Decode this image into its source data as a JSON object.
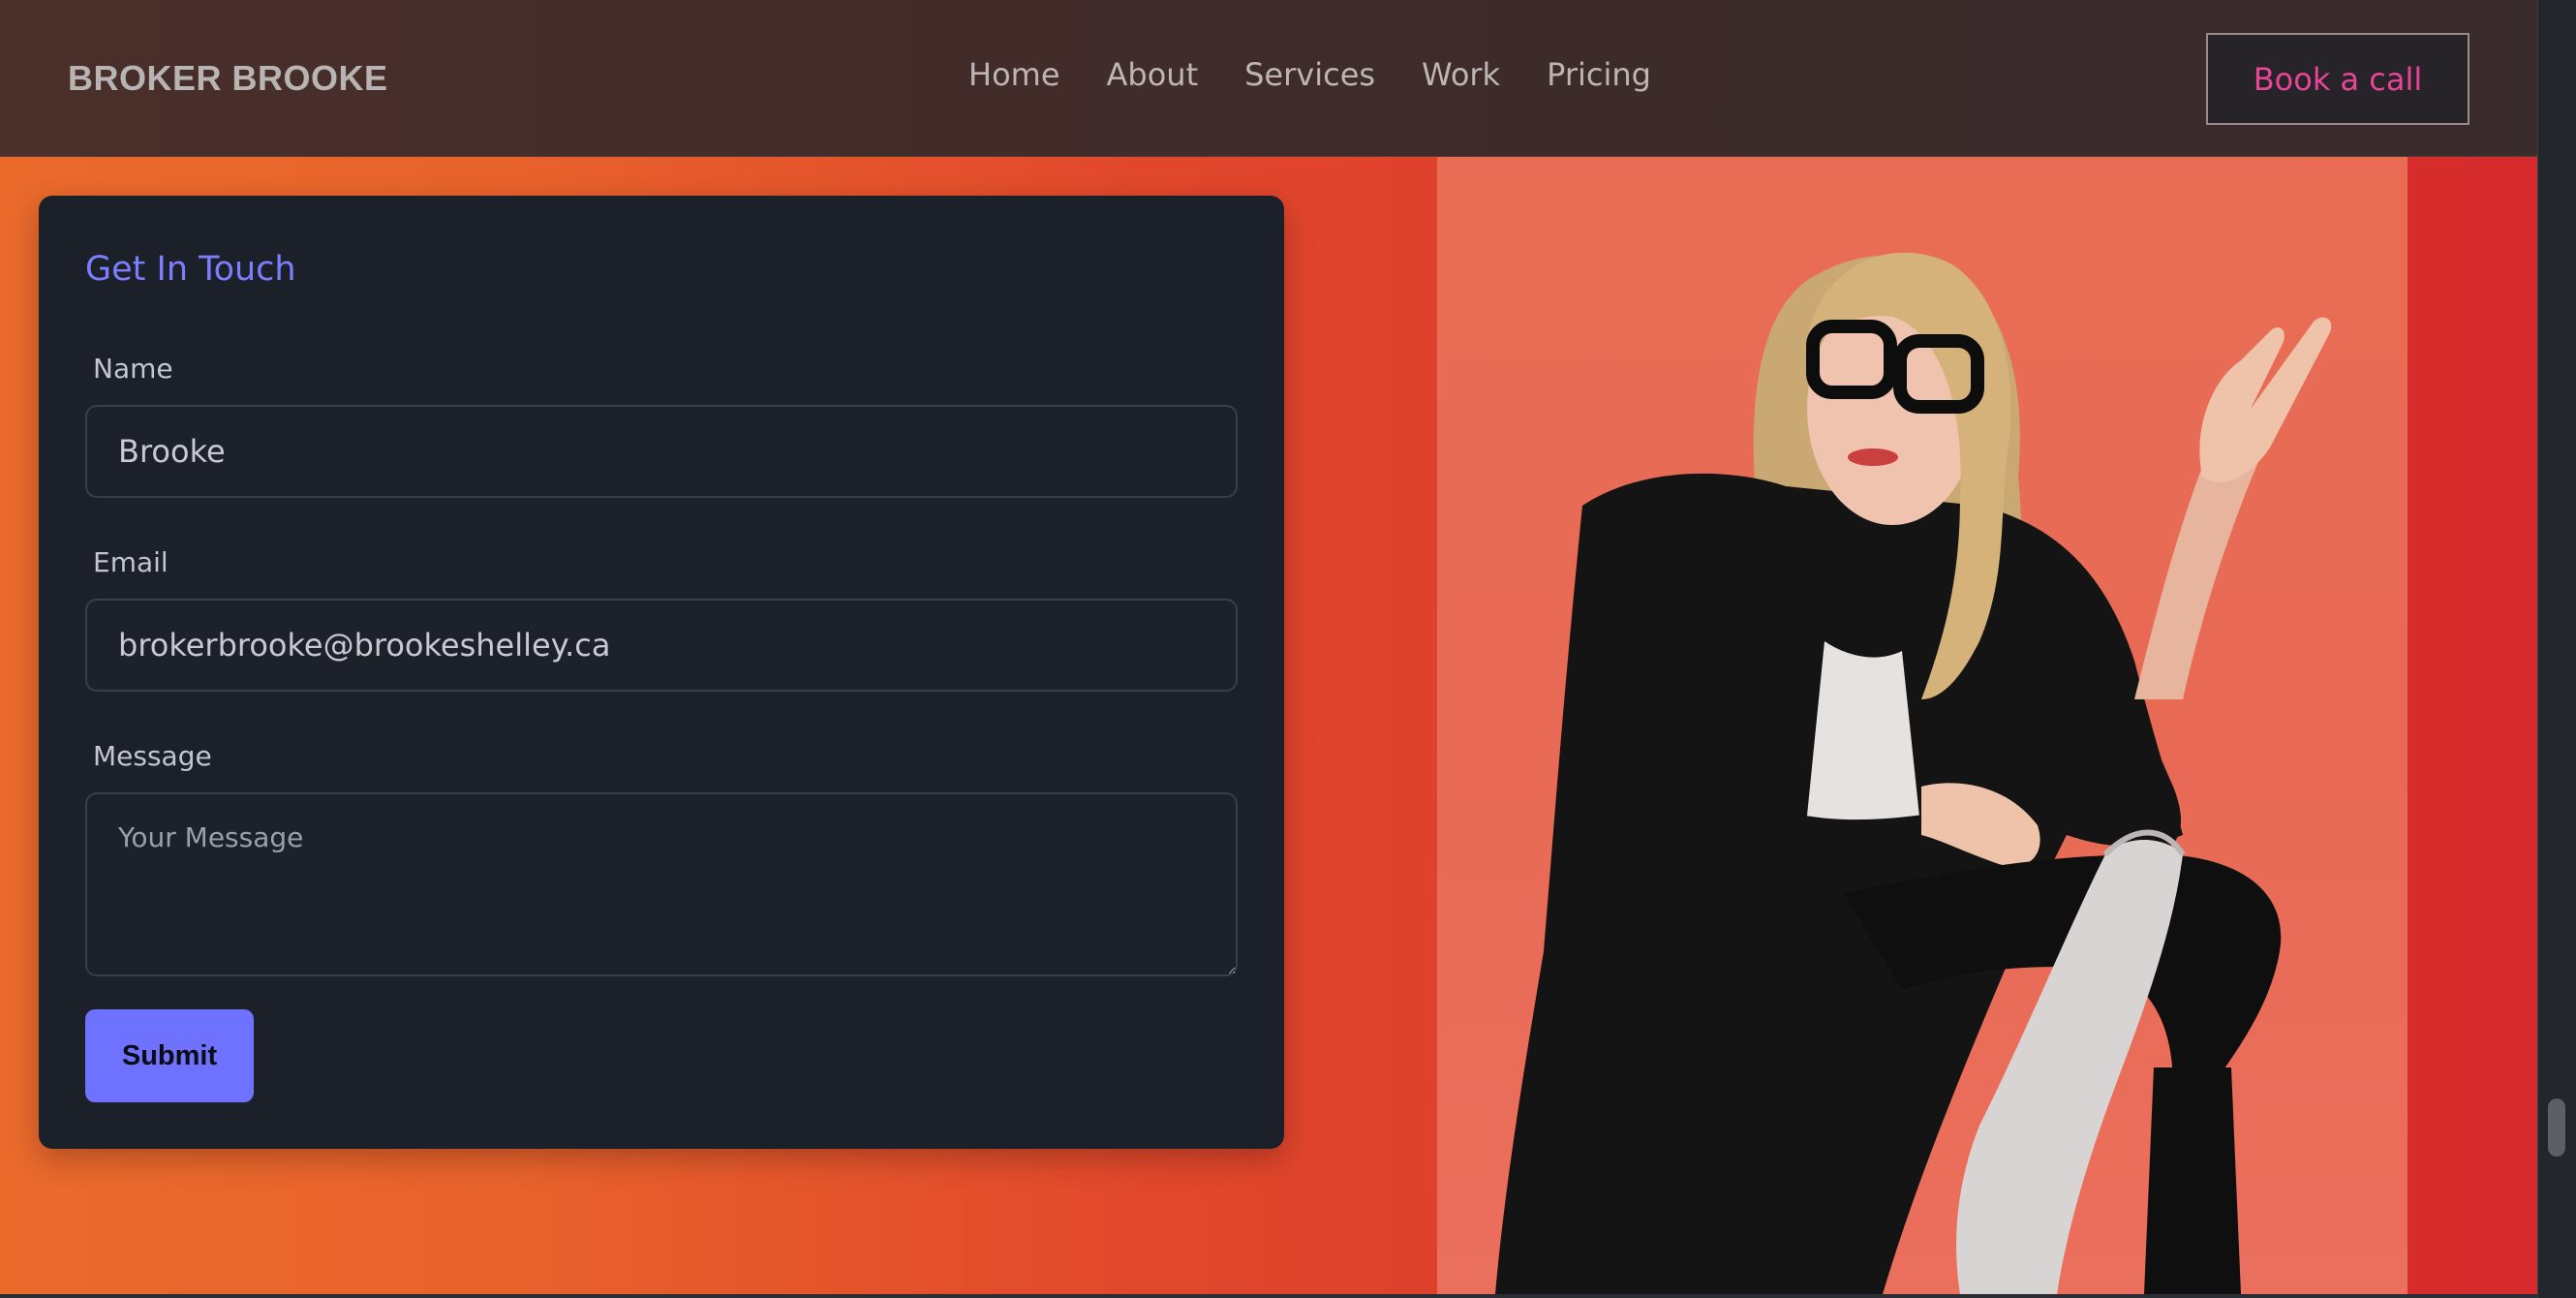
{
  "header": {
    "brand": "BROKER BROOKE",
    "nav": [
      "Home",
      "About",
      "Services",
      "Work",
      "Pricing"
    ],
    "cta_label": "Book a call"
  },
  "contact_form": {
    "title": "Get In Touch",
    "name_label": "Name",
    "name_value": "Brooke",
    "email_label": "Email",
    "email_value": "brokerbrooke@brookeshelley.ca",
    "message_label": "Message",
    "message_placeholder": "Your Message",
    "submit_label": "Submit"
  },
  "colors": {
    "accent": "#6f72ff",
    "cta_text": "#e94597",
    "card_bg": "#1c2028",
    "hero_gradient_start": "#ea6a2c",
    "hero_gradient_end": "#d62a2c"
  },
  "photo": {
    "icon": "portrait-photo"
  }
}
